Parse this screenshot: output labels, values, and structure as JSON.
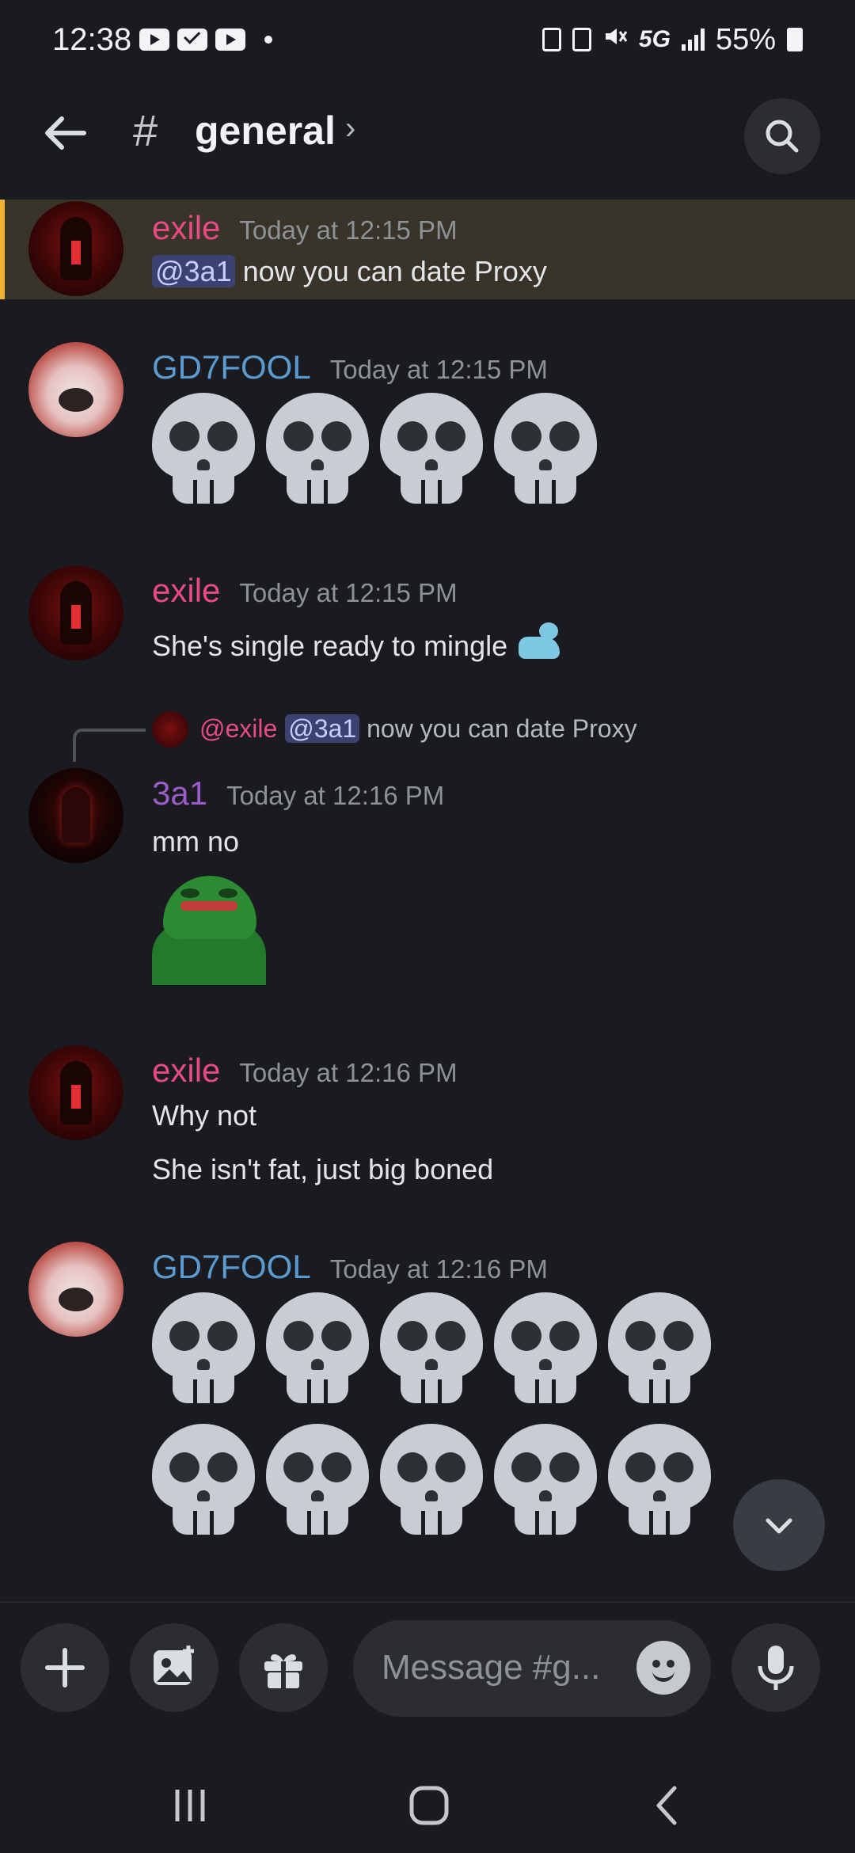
{
  "status_bar": {
    "time": "12:38",
    "network": "5G",
    "battery": "55%"
  },
  "header": {
    "hash": "#",
    "channel": "general",
    "chevron": "›"
  },
  "messages": [
    {
      "author": "exile",
      "time": "Today at 12:15 PM",
      "mention": "@3a1",
      "text": " now you can date Proxy"
    },
    {
      "author": "GD7FOOL",
      "time": "Today at 12:15 PM",
      "emoji": "skull"
    },
    {
      "author": "exile",
      "time": "Today at 12:15 PM",
      "text": "She's single ready to mingle "
    },
    {
      "reply": {
        "author": "@exile",
        "mention": "@3a1",
        "text": " now you can date Proxy"
      },
      "author": "3a1",
      "time": "Today at 12:16 PM",
      "text": "mm no",
      "sticker": "pepe-sticker"
    },
    {
      "author": "exile",
      "time": "Today at 12:16 PM",
      "text": "Why not",
      "text2": "She isn't fat, just big boned"
    },
    {
      "author": "GD7FOOL",
      "time": "Today at 12:16 PM",
      "emoji": "skull"
    }
  ],
  "composer": {
    "placeholder": "Message #g..."
  },
  "colors": {
    "background": "#1a1b20",
    "highlight": "#38342a",
    "mention_bg": "#3c4270",
    "pink_author": "#e84a82",
    "blue_author": "#5a9bd1",
    "purple_author": "#9b5bc9"
  }
}
